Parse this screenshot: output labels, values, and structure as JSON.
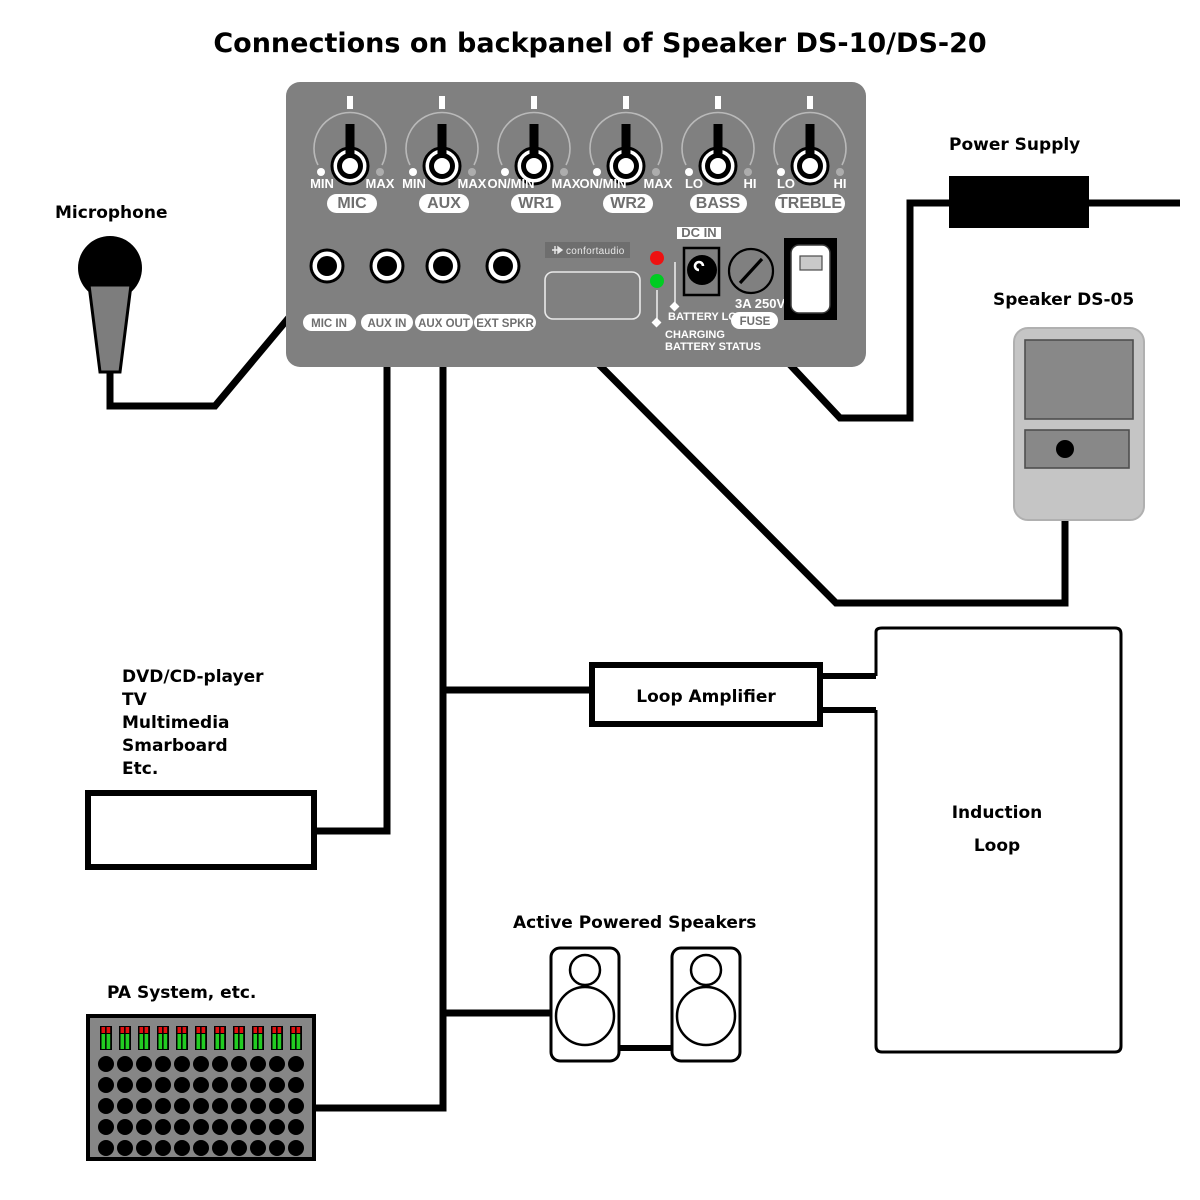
{
  "title": "Connections on backpanel of Speaker DS-10/DS-20",
  "panel": {
    "brand": "confortaudio",
    "knobs": [
      {
        "name": "MIC",
        "min_label": "MIN",
        "max_label": "MAX"
      },
      {
        "name": "AUX",
        "min_label": "MIN",
        "max_label": "MAX"
      },
      {
        "name": "WR1",
        "min_label": "ON/MIN",
        "max_label": "MAX"
      },
      {
        "name": "WR2",
        "min_label": "ON/MIN",
        "max_label": "MAX"
      },
      {
        "name": "BASS",
        "min_label": "LO",
        "max_label": "HI"
      },
      {
        "name": "TREBLE",
        "min_label": "LO",
        "max_label": "HI"
      }
    ],
    "jacks": [
      {
        "label": "MIC IN"
      },
      {
        "label": "AUX IN"
      },
      {
        "label": "AUX OUT"
      },
      {
        "label": "EXT SPKR"
      }
    ],
    "dc_in_label": "DC IN",
    "battery_low_label": "BATTERY LOW",
    "charging_label": "CHARGING",
    "battery_status_label": "BATTERY STATUS",
    "fuse_rating": "3A 250V",
    "fuse_label": "FUSE",
    "led_low_color": "#ee1111",
    "led_charge_color": "#00cc22",
    "panel_color": "#808080"
  },
  "devices": {
    "microphone": {
      "label": "Microphone"
    },
    "power_supply": {
      "label": "Power Supply"
    },
    "speaker_ds05": {
      "label": "Speaker DS-05"
    },
    "sources": {
      "lines": [
        "DVD/CD-player",
        "TV",
        "Multimedia",
        "Smarboard",
        "Etc."
      ]
    },
    "pa_system": {
      "label": "PA System, etc.",
      "meter_count": 11,
      "knob_rows": 5,
      "knob_cols": 11
    },
    "active_speakers": {
      "label": "Active Powered Speakers",
      "count": 2
    },
    "loop_amplifier": {
      "label": "Loop Amplifier"
    },
    "induction_loop": {
      "line1": "Induction",
      "line2": "Loop"
    }
  }
}
